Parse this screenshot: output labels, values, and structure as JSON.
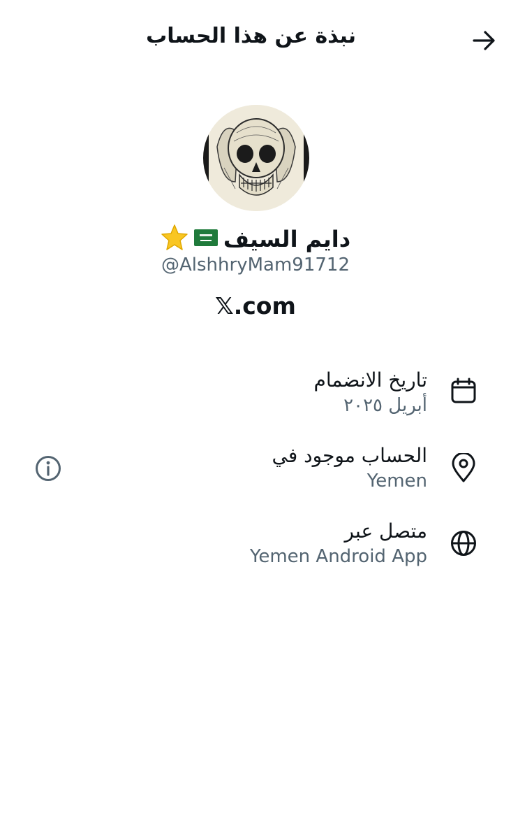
{
  "header": {
    "title": "نبذة عن هذا الحساب",
    "back_icon": "arrow-right-icon"
  },
  "profile": {
    "display_name": "دايم السيف",
    "name_emojis": [
      "saudi-flag",
      "star"
    ],
    "handle": "@AlshhryMam91712",
    "website": "𝕏.com"
  },
  "info": {
    "joined": {
      "label": "تاريخ الانضمام",
      "value": "أبريل ٢٠٢٥",
      "icon": "calendar-icon"
    },
    "location": {
      "label": "الحساب موجود في",
      "value": "Yemen",
      "icon": "location-pin-icon",
      "extra_icon": "info-circle-icon"
    },
    "connected": {
      "label": "متصل عبر",
      "value": "Yemen Android App",
      "icon": "globe-icon"
    }
  },
  "colors": {
    "text": "#0f1419",
    "secondary": "#536471",
    "flag_green": "#1f7a3b",
    "star": "#f9c623"
  }
}
